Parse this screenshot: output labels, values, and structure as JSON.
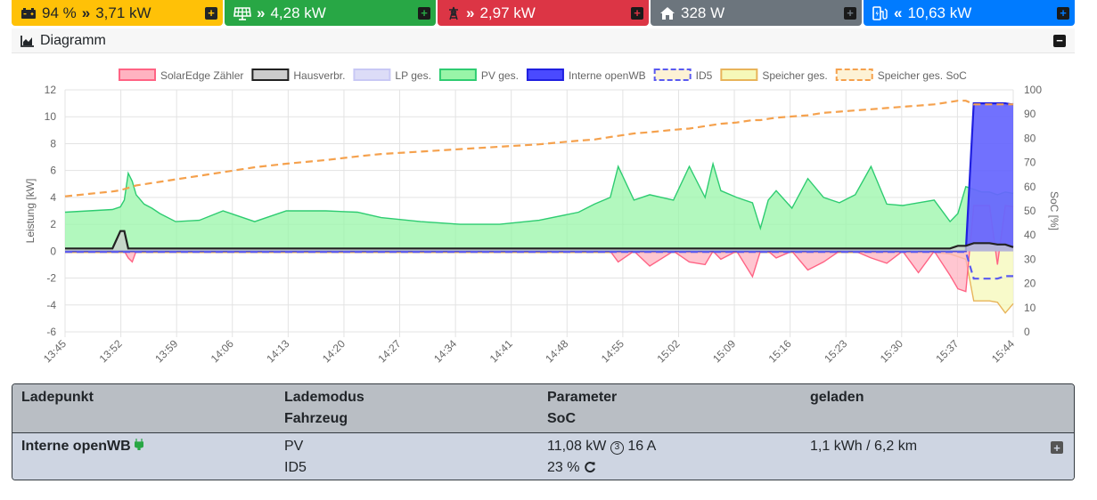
{
  "topbar": {
    "battery": {
      "soc": "94 %",
      "arrows": "»",
      "power": "3,71 kW"
    },
    "pv": {
      "arrows": "»",
      "power": "4,28 kW"
    },
    "grid": {
      "arrows": "»",
      "power": "2,97 kW"
    },
    "house": {
      "power": "328 W"
    },
    "chargepoint": {
      "arrows": "«",
      "power": "10,63 kW"
    }
  },
  "chart_card": {
    "title": "Diagramm"
  },
  "chart_data": {
    "type": "area",
    "title": "",
    "ylabel": "Leistung [kW]",
    "y2label": "SoC [%]",
    "ylim": [
      -6,
      12
    ],
    "y2lim": [
      0,
      100
    ],
    "yticks": [
      "12",
      "10",
      "8",
      "6",
      "4",
      "2",
      "0",
      "-2",
      "-4",
      "-6"
    ],
    "y2ticks": [
      "100",
      "90",
      "80",
      "70",
      "60",
      "50",
      "40",
      "30",
      "20",
      "10",
      "0"
    ],
    "xticks": [
      "13:45",
      "13:52",
      "13:59",
      "14:06",
      "14:13",
      "14:20",
      "14:27",
      "14:34",
      "14:41",
      "14:48",
      "14:55",
      "15:02",
      "15:09",
      "15:16",
      "15:23",
      "15:30",
      "15:37",
      "15:44"
    ],
    "legend_position": "top",
    "x_minutes": [
      0,
      6,
      7,
      7.5,
      8,
      8.5,
      9,
      10,
      11,
      12,
      14,
      17,
      20,
      24,
      28,
      33,
      37,
      40,
      45,
      50,
      55,
      60,
      65,
      67,
      69,
      70,
      72,
      74,
      77,
      79,
      81,
      82,
      83,
      85,
      87,
      88,
      89,
      90,
      92,
      94,
      96,
      98,
      100,
      102,
      104,
      106,
      108,
      110,
      112,
      113,
      114,
      115,
      116,
      117,
      118,
      119,
      120
    ],
    "series": [
      {
        "name": "SolarEdge Zähler",
        "color": "#ff6384",
        "fill": "#ffb3c1",
        "values": [
          0,
          0,
          0,
          0,
          -0.5,
          -0.8,
          0,
          0,
          0,
          0,
          0,
          0,
          0,
          0,
          0,
          0,
          0,
          0,
          0,
          0,
          0,
          0,
          0,
          0,
          0,
          -0.8,
          0,
          -1.1,
          0,
          -0.8,
          -1,
          0,
          -0.6,
          0,
          -1.9,
          0,
          0,
          -0.5,
          0,
          -1.4,
          -0.8,
          0,
          0,
          -0.5,
          -0.9,
          0,
          -1.6,
          0,
          -1.8,
          -2.8,
          -3,
          3.4,
          3.4,
          3.4,
          -1,
          3.4,
          3.3
        ]
      },
      {
        "name": "Hausverbr.",
        "color": "#222222",
        "fill": "#cccccc",
        "values": [
          0.2,
          0.2,
          1.5,
          1.5,
          0.2,
          0.2,
          0.2,
          0.2,
          0.2,
          0.2,
          0.2,
          0.2,
          0.2,
          0.2,
          0.2,
          0.2,
          0.2,
          0.2,
          0.2,
          0.2,
          0.2,
          0.2,
          0.2,
          0.2,
          0.2,
          0.2,
          0.2,
          0.2,
          0.2,
          0.2,
          0.2,
          0.2,
          0.2,
          0.2,
          0.2,
          0.2,
          0.2,
          0.2,
          0.2,
          0.2,
          0.2,
          0.2,
          0.2,
          0.2,
          0.2,
          0.2,
          0.2,
          0.2,
          0.2,
          0.4,
          0.4,
          0.6,
          0.6,
          0.6,
          0.5,
          0.5,
          0.3
        ]
      },
      {
        "name": "LP ges.",
        "color": "#c8c8f5",
        "fill": "#dcdcf7",
        "values": [
          0,
          0,
          0,
          0,
          0,
          0,
          0,
          0,
          0,
          0,
          0,
          0,
          0,
          0,
          0,
          0,
          0,
          0,
          0,
          0,
          0,
          0,
          0,
          0,
          0,
          0,
          0,
          0,
          0,
          0,
          0,
          0,
          0,
          0,
          0,
          0,
          0,
          0,
          0,
          0,
          0,
          0,
          0,
          0,
          0,
          0,
          0,
          0,
          0,
          0,
          0,
          11,
          11,
          11,
          11,
          10.8,
          11
        ]
      },
      {
        "name": "PV ges.",
        "color": "#2ecc71",
        "fill": "#98f5a8",
        "values": [
          2.9,
          3.1,
          3.3,
          3.8,
          5.8,
          5.2,
          4.2,
          3.5,
          3.2,
          2.8,
          2.2,
          2.3,
          3.0,
          2.2,
          3.0,
          3.0,
          2.9,
          2.5,
          2.2,
          2.0,
          2.0,
          2.3,
          2.9,
          3.5,
          4.0,
          6.3,
          3.8,
          4.2,
          3.8,
          6.3,
          4.0,
          6.5,
          4.5,
          4.0,
          3.6,
          1.7,
          3.8,
          4.5,
          3.2,
          5.4,
          4.0,
          3.6,
          4.2,
          6.3,
          3.5,
          3.4,
          3.6,
          3.8,
          2.2,
          2.8,
          4.8,
          4.6,
          4.4,
          4.4,
          4.2,
          4.4,
          4.3
        ]
      },
      {
        "name": "Interne openWB",
        "color": "#1f1fe0",
        "fill": "#4a4aff",
        "values": [
          0,
          0,
          0,
          0,
          0,
          0,
          0,
          0,
          0,
          0,
          0,
          0,
          0,
          0,
          0,
          0,
          0,
          0,
          0,
          0,
          0,
          0,
          0,
          0,
          0,
          0,
          0,
          0,
          0,
          0,
          0,
          0,
          0,
          0,
          0,
          0,
          0,
          0,
          0,
          0,
          0,
          0,
          0,
          0,
          0,
          0,
          0,
          0,
          0,
          0,
          0,
          11,
          11,
          11,
          11,
          11,
          10.9
        ]
      },
      {
        "name": "ID5",
        "color": "#5a5af0",
        "fill": "none",
        "dashed": true,
        "axis": "soc",
        "values": [
          33,
          33,
          33,
          33,
          33,
          33,
          33,
          33,
          33,
          33,
          33,
          33,
          33,
          33,
          33,
          33,
          33,
          33,
          33,
          33,
          33,
          33,
          33,
          33,
          33,
          33,
          33,
          33,
          33,
          33,
          33,
          33,
          33,
          33,
          33,
          33,
          33,
          33,
          33,
          33,
          33,
          33,
          33,
          33,
          33,
          33,
          33,
          33,
          33,
          33,
          33,
          22,
          22,
          22,
          22,
          23,
          23
        ]
      },
      {
        "name": "Speicher ges.",
        "color": "#e8b45a",
        "fill": "#f6f8b8",
        "values": [
          -0.1,
          -0.1,
          -0.1,
          -0.1,
          -0.1,
          -0.1,
          -0.1,
          -0.1,
          -0.1,
          -0.1,
          -0.1,
          -0.1,
          -0.1,
          -0.1,
          -0.1,
          -0.1,
          -0.1,
          -0.1,
          -0.1,
          -0.1,
          -0.1,
          -0.1,
          -0.1,
          -0.1,
          -0.1,
          -0.1,
          -0.1,
          -0.1,
          -0.1,
          -0.1,
          -0.1,
          -0.1,
          -0.1,
          -0.1,
          -0.1,
          -0.1,
          -0.1,
          -0.1,
          -0.1,
          -0.1,
          -0.1,
          -0.1,
          -0.1,
          -0.1,
          -0.1,
          -0.1,
          -0.1,
          -0.1,
          -0.2,
          -0.4,
          -0.6,
          -3.7,
          -3.7,
          -3.7,
          -3.8,
          -4.6,
          -3.9
        ]
      },
      {
        "name": "Speicher ges. SoC",
        "color": "#f5a14d",
        "fill": "none",
        "dashed": true,
        "axis": "soc",
        "values": [
          56,
          58,
          58.5,
          59,
          59.5,
          60,
          60.5,
          61,
          61.5,
          62,
          63,
          64.5,
          66,
          68,
          69.5,
          71,
          72.5,
          73.5,
          74.5,
          75.5,
          76.5,
          77.5,
          79,
          79.5,
          80.5,
          81,
          82,
          82.5,
          83.5,
          84,
          85,
          85.5,
          86,
          86.5,
          87.5,
          87.5,
          88,
          88.5,
          89,
          89.5,
          90.5,
          91,
          91.5,
          92,
          92.5,
          93,
          93.5,
          94,
          95,
          95.5,
          95.5,
          94,
          94,
          94,
          94,
          94,
          94
        ]
      }
    ]
  },
  "table": {
    "head": {
      "col1": "Ladepunkt",
      "col2a": "Lademodus",
      "col2b": "Fahrzeug",
      "col3a": "Parameter",
      "col3b": "SoC",
      "col4": "geladen"
    },
    "row": {
      "name": "Interne openWB",
      "mode": "PV",
      "vehicle": "ID5",
      "power": "11,08 kW",
      "phases": "3",
      "current": "16 A",
      "soc": "23 %",
      "charged": "1,1 kWh / 6,2 km"
    }
  }
}
